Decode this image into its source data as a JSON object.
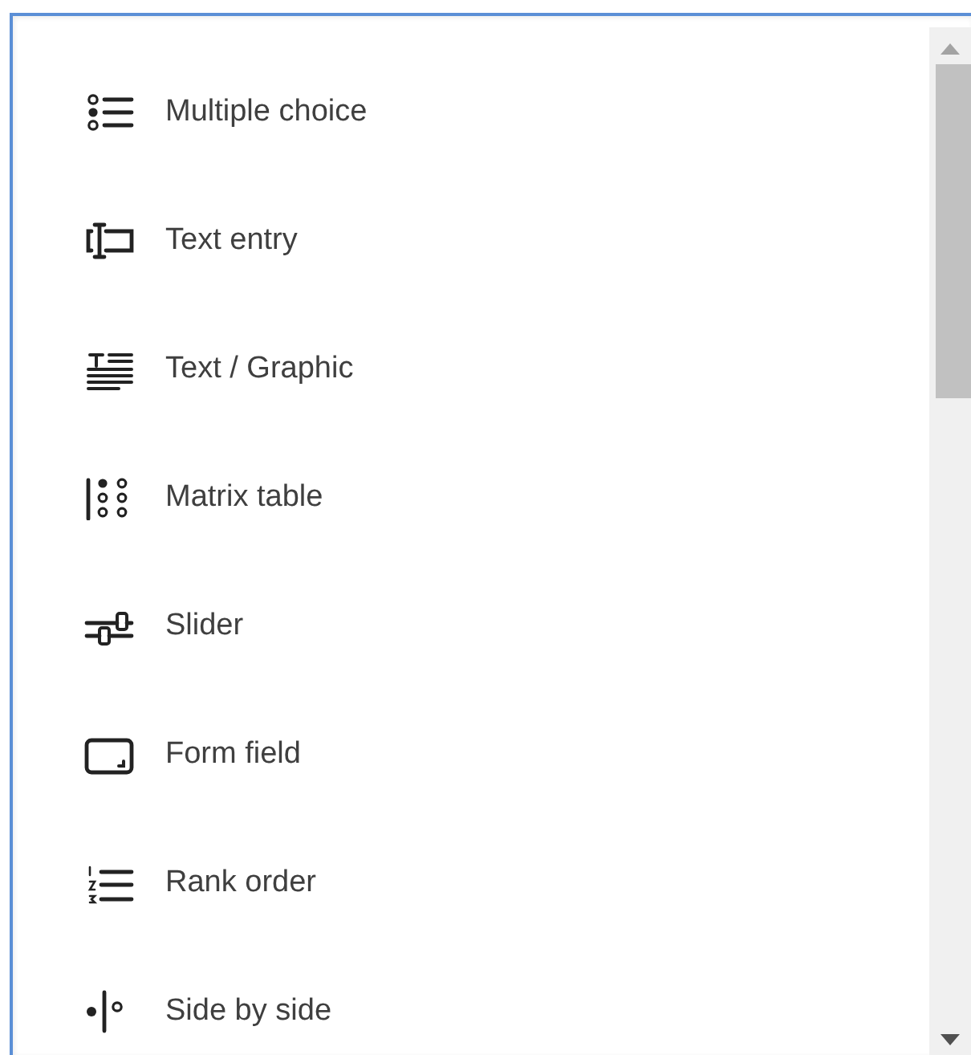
{
  "question_types": [
    {
      "kind": "multiple-choice",
      "label": "Multiple choice"
    },
    {
      "kind": "text-entry",
      "label": "Text entry"
    },
    {
      "kind": "text-graphic",
      "label": "Text / Graphic"
    },
    {
      "kind": "matrix",
      "label": "Matrix table"
    },
    {
      "kind": "slider",
      "label": "Slider"
    },
    {
      "kind": "form-field",
      "label": "Form field"
    },
    {
      "kind": "rank-order",
      "label": "Rank order"
    },
    {
      "kind": "side-by-side",
      "label": "Side by side"
    }
  ]
}
